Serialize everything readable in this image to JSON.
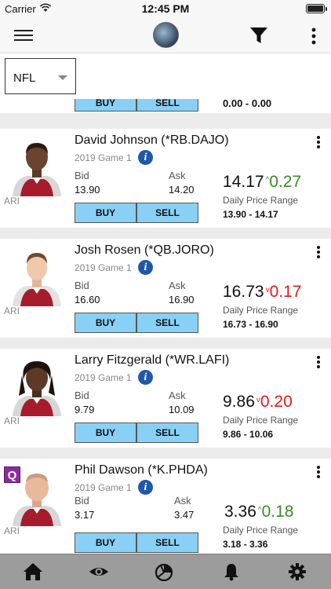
{
  "status": {
    "carrier": "Carrier",
    "time": "12:45 PM"
  },
  "nav": {
    "menu_icon": "hamburger-icon",
    "filter_icon": "filter-icon",
    "more_icon": "more-vertical-icon"
  },
  "league_select": {
    "value": "NFL"
  },
  "partial_card": {
    "buy": "BUY",
    "sell": "SELL",
    "range": "0.00 - 0.00"
  },
  "labels": {
    "bid": "Bid",
    "ask": "Ask",
    "daily_price_range": "Daily Price Range",
    "buy": "BUY",
    "sell": "SELL",
    "info": "i"
  },
  "players": [
    {
      "name": "David Johnson (*RB.DAJO)",
      "game": "2019 Game 1",
      "team": "ARI",
      "bid": "13.90",
      "ask": "14.20",
      "price": "14.17",
      "direction": "up",
      "arrow": "^",
      "change": "0.27",
      "range": "13.90 - 14.17",
      "badge": ""
    },
    {
      "name": "Josh Rosen (*QB.JORO)",
      "game": "2019 Game 1",
      "team": "ARI",
      "bid": "16.60",
      "ask": "16.90",
      "price": "16.73",
      "direction": "down",
      "arrow": "v",
      "change": "0.17",
      "range": "16.73 - 16.90",
      "badge": ""
    },
    {
      "name": "Larry Fitzgerald (*WR.LAFI)",
      "game": "2019 Game 1",
      "team": "ARI",
      "bid": "9.79",
      "ask": "10.09",
      "price": "9.86",
      "direction": "down",
      "arrow": "v",
      "change": "0.20",
      "range": "9.86 - 10.06",
      "badge": ""
    },
    {
      "name": "Phil Dawson (*K.PHDA)",
      "game": "2019 Game 1",
      "team": "ARI",
      "bid": "3.17",
      "ask": "3.47",
      "price": "3.36",
      "direction": "up",
      "arrow": "^",
      "change": "0.18",
      "range": "3.18 - 3.36",
      "badge": "Q"
    }
  ],
  "colors": {
    "up": "#3a8a2a",
    "down": "#e01b1b",
    "button": "#88d0f5",
    "info": "#1f58a8",
    "tabbar": "#9c9c9c"
  },
  "tabs": [
    {
      "icon": "home-icon"
    },
    {
      "icon": "eye-icon"
    },
    {
      "icon": "pie-chart-icon"
    },
    {
      "icon": "bell-icon"
    },
    {
      "icon": "gear-icon"
    }
  ]
}
